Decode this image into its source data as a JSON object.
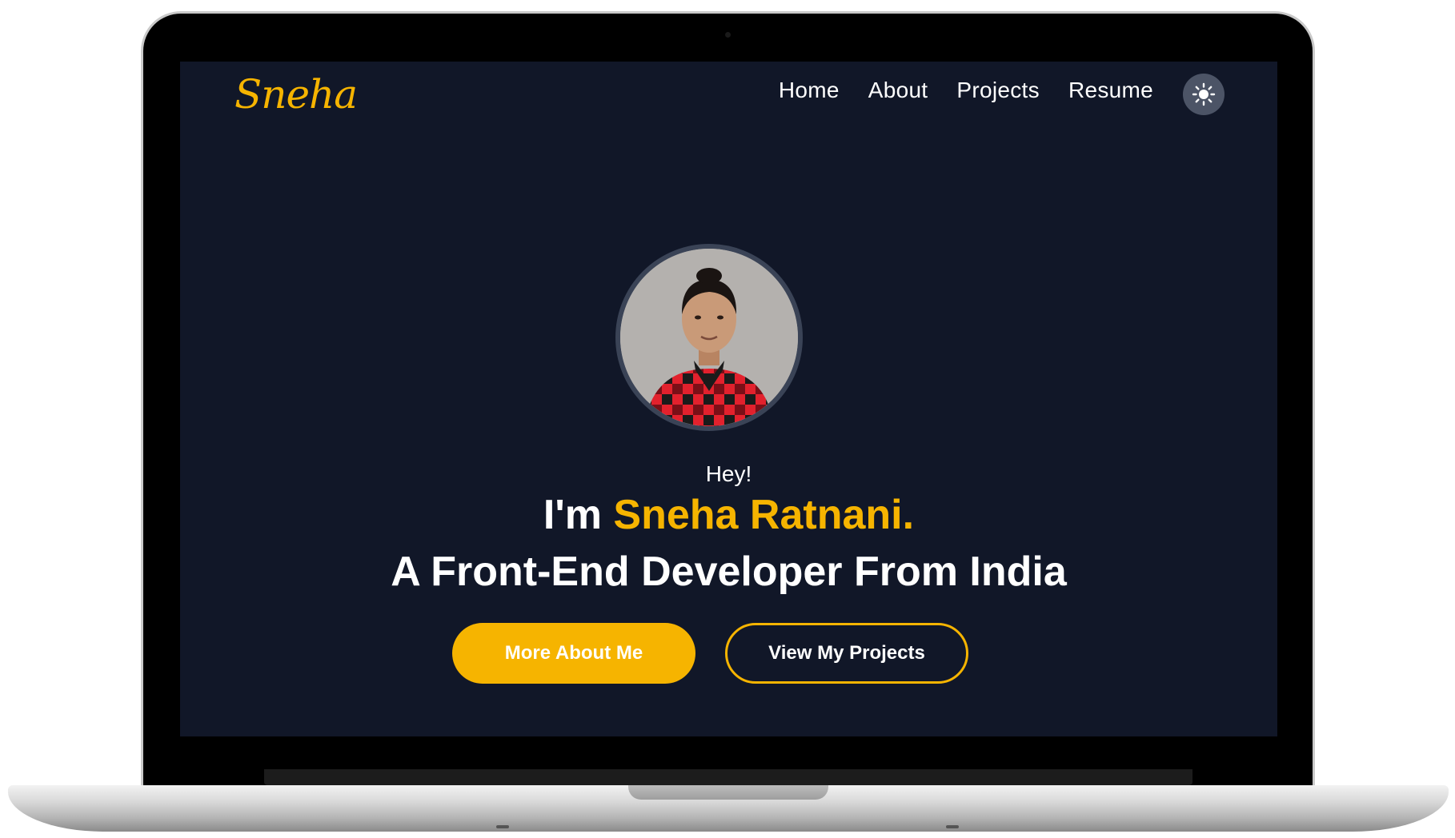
{
  "brand": {
    "logo_text": "Sneha",
    "accent_color": "#f6b400",
    "background_color": "#111728"
  },
  "nav": {
    "items": [
      {
        "label": "Home"
      },
      {
        "label": "About"
      },
      {
        "label": "Projects"
      },
      {
        "label": "Resume"
      }
    ],
    "theme_toggle_icon": "sun-icon"
  },
  "hero": {
    "avatar_icon": "profile-photo",
    "greeting": "Hey!",
    "name_prefix": "I'm ",
    "name": "Sneha Ratnani.",
    "tagline": "A Front-End Developer From India",
    "primary_button": "More About Me",
    "secondary_button": "View My Projects"
  }
}
